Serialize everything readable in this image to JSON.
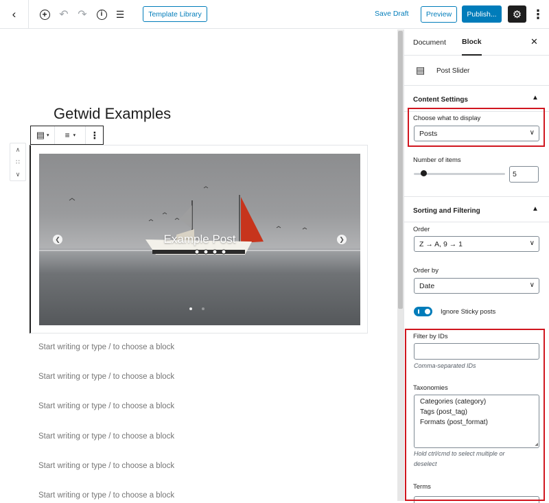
{
  "toolbar": {
    "template_library": "Template Library",
    "save_draft": "Save Draft",
    "preview": "Preview",
    "publish": "Publish..."
  },
  "editor": {
    "title": "Getwid Examples",
    "slide_caption": "Example Post",
    "placeholders": [
      "Start writing or type / to choose a block",
      "Start writing or type / to choose a block",
      "Start writing or type / to choose a block",
      "Start writing or type / to choose a block",
      "Start writing or type / to choose a block",
      "Start writing or type / to choose a block"
    ]
  },
  "sidebar": {
    "tabs": [
      "Document",
      "Block"
    ],
    "active_tab": "Block",
    "block_name": "Post Slider",
    "content_settings": {
      "title": "Content Settings",
      "display_label": "Choose what to display",
      "display_value": "Posts",
      "items_label": "Number of items",
      "items_value": "5"
    },
    "sorting": {
      "title": "Sorting and Filtering",
      "order_label": "Order",
      "order_value": "Z → A, 9 → 1",
      "orderby_label": "Order by",
      "orderby_value": "Date",
      "sticky_label": "Ignore Sticky posts",
      "sticky_on": true,
      "filter_ids_label": "Filter by IDs",
      "filter_ids_help": "Comma-separated IDs",
      "taxonomies_label": "Taxonomies",
      "taxonomies": [
        "Categories (category)",
        "Tags (post_tag)",
        "Formats (post_format)"
      ],
      "taxonomies_help_1": "Hold ctrl/cmd to select multiple or",
      "taxonomies_help_2": "deselect",
      "terms_label": "Terms"
    }
  },
  "colors": {
    "accent": "#007cba",
    "highlight": "#d0151e",
    "sail": "#c7341c"
  }
}
